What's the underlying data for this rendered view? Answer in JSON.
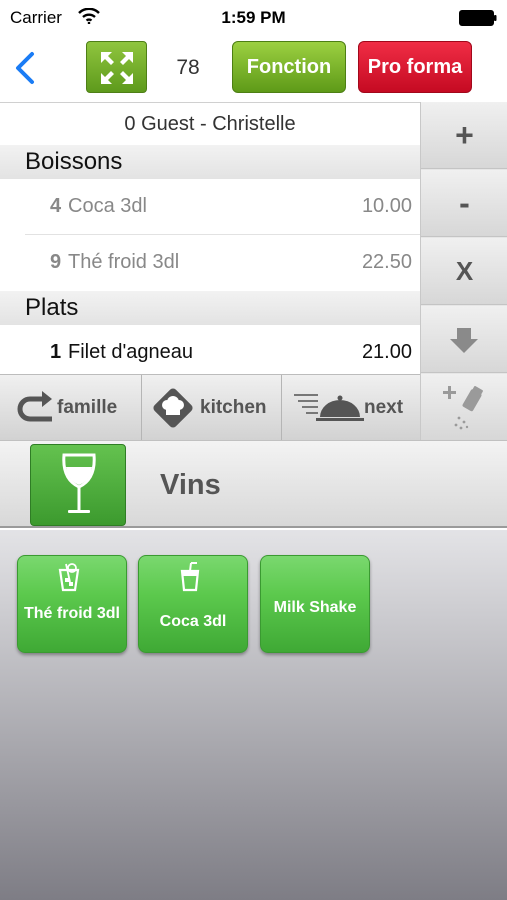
{
  "status_bar": {
    "carrier": "Carrier",
    "time": "1:59 PM"
  },
  "nav": {
    "count": "78",
    "fonction_label": "Fonction",
    "proforma_label": "Pro forma"
  },
  "order": {
    "guest": "0 Guest - Christelle",
    "sections": [
      {
        "title": "Boissons",
        "items": [
          {
            "qty": "4",
            "name": "Coca 3dl",
            "price": "10.00"
          },
          {
            "qty": "9",
            "name": "Thé froid 3dl",
            "price": "22.50"
          }
        ]
      },
      {
        "title": "Plats",
        "items": [
          {
            "qty": "1",
            "name": "Filet d'agneau",
            "price": "21.00"
          }
        ]
      }
    ]
  },
  "side_buttons": {
    "plus": "+",
    "minus": "-",
    "delete": "X"
  },
  "actions": {
    "famille": "famille",
    "kitchen": "kitchen",
    "next": "next"
  },
  "category": {
    "title": "Vins"
  },
  "products": [
    {
      "label": "Thé froid 3dl",
      "icon": "iced-tea-icon"
    },
    {
      "label": "Coca 3dl",
      "icon": "soda-cup-icon"
    },
    {
      "label": "Milk Shake",
      "icon": ""
    }
  ],
  "colors": {
    "green": "#5cc94d",
    "red": "#d9142e",
    "nav_green": "#7cb82f",
    "back_blue": "#1a7cf5"
  }
}
